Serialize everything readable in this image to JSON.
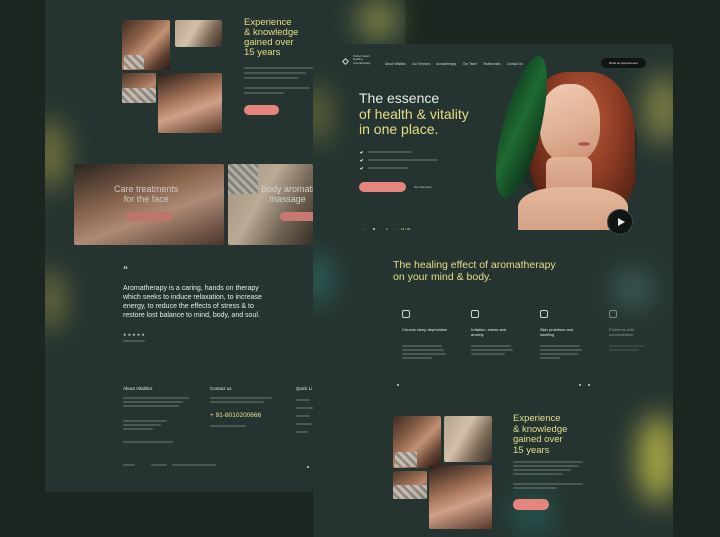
{
  "back": {
    "experience_heading": [
      "Experience",
      "& knowledge",
      "gained over",
      "15 years"
    ],
    "cards": [
      {
        "label": "Care treatments\nfor the face"
      },
      {
        "label": "Body aromati\nmassage"
      }
    ],
    "quote_mark": "“",
    "quote": "Aromatherapy is a caring, hands on therapy which seeks to induce relaxation, to increase energy, to reduce the effects of stress & to restore lost balance to mind, body, and soul.",
    "stars": "★★★★★",
    "footer": {
      "about_heading": "About Vitalitics",
      "contact_heading": "Contact us",
      "phone": "+ 91-8010200666",
      "quick_heading": "Quick Li"
    }
  },
  "front": {
    "logo_text": [
      "Perfect Heart",
      "Healing",
      "Aromatherapy"
    ],
    "nav": [
      "About Vitalitics",
      "Our Services",
      "Aromatherapy",
      "Our Team",
      "Testimonials",
      "Contact Us"
    ],
    "cta_button": "Book an Appointment",
    "hero_heading": [
      "The essence",
      "of health & vitality",
      "in one place."
    ],
    "hero_bullets": 3,
    "hero_button_secondary": "Our Services",
    "slider_counter": "01 / 04",
    "section_heading": [
      "The healing effect of aromatherapy",
      "on your mind & body."
    ],
    "cards": [
      {
        "title": "Chronic sleep deprivation",
        "icon": "sleep-icon"
      },
      {
        "title": "Irritation, stress and anxiety",
        "icon": "stress-icon"
      },
      {
        "title": "Skin problems and swelling",
        "icon": "skin-icon"
      },
      {
        "title": "Problems with concentration",
        "icon": "focus-icon"
      }
    ],
    "experience_heading": [
      "Experience",
      "& knowledge",
      "gained over",
      "15 years"
    ]
  },
  "colors": {
    "bg": "#1b2620",
    "panel": "#253430",
    "accent_yellow": "#e6de86",
    "accent_pink": "#e6857e"
  }
}
